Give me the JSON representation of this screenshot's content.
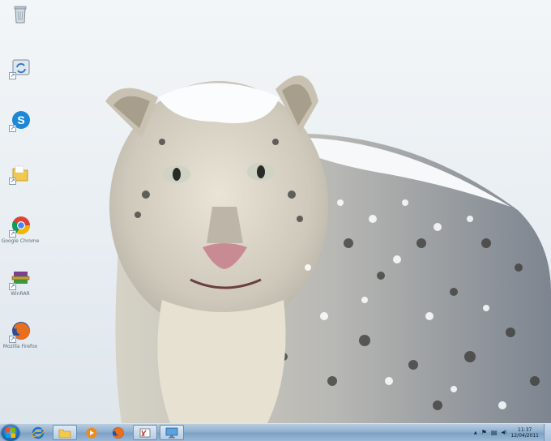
{
  "desktop": {
    "icons": [
      {
        "name": "recycle-bin",
        "label": ""
      },
      {
        "name": "sync",
        "label": ""
      },
      {
        "name": "skype",
        "label": ""
      },
      {
        "name": "folder",
        "label": ""
      },
      {
        "name": "google-chrome",
        "label": "Google Chrome"
      },
      {
        "name": "winrar",
        "label": "WinRAR"
      },
      {
        "name": "mozilla-firefox",
        "label": "Mozilla Firefox"
      }
    ]
  },
  "taskbar": {
    "pinned": [
      "internet-explorer",
      "windows-explorer",
      "media-player",
      "firefox",
      "snipping-tool",
      "remote-desktop"
    ],
    "tray": {
      "chevron": "▲",
      "flag": "⚑",
      "network": "▤",
      "volume": "◀)",
      "time": "11:37",
      "date": "12/04/2011"
    }
  },
  "colors": {
    "taskbar": "#8fb0cf",
    "wallpaper_sky": "#eef2f5"
  }
}
